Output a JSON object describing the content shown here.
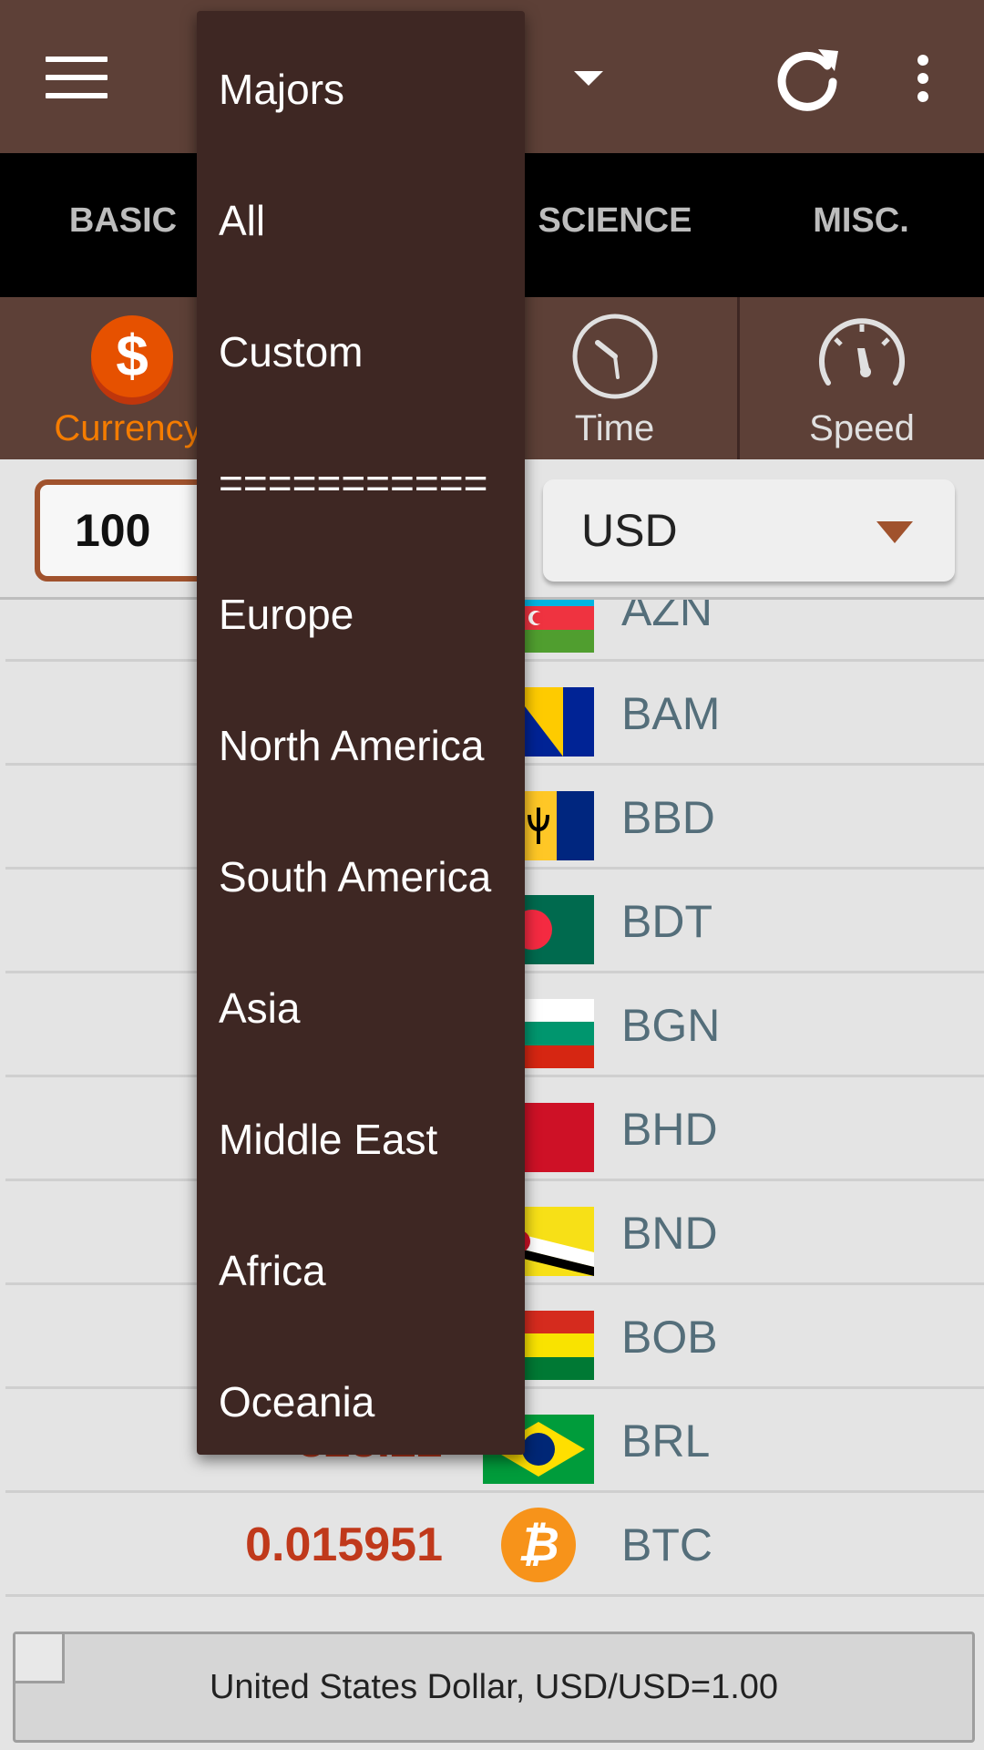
{
  "app_bar": {
    "menu_icon": "hamburger-menu-icon",
    "category_caret_icon": "caret-down-icon",
    "refresh_icon": "refresh-icon",
    "overflow_icon": "more-vert-icon"
  },
  "tabs": [
    {
      "label": "BASIC"
    },
    {
      "label": "SCIENCE"
    },
    {
      "label": "MISC."
    }
  ],
  "units": [
    {
      "label": "Currency",
      "icon": "dollar-coin-icon",
      "active": true
    },
    {
      "label": "Time",
      "icon": "clock-icon",
      "active": false
    },
    {
      "label": "Speed",
      "icon": "speedometer-icon",
      "active": false
    }
  ],
  "input": {
    "amount": "100",
    "unit": "USD"
  },
  "currency_rows": [
    {
      "value": "",
      "code": "AZN",
      "flag": "azerbaijan-flag"
    },
    {
      "value": "",
      "code": "BAM",
      "flag": "bosnia-flag"
    },
    {
      "value": "",
      "code": "BBD",
      "flag": "barbados-flag"
    },
    {
      "value": "",
      "code": "BDT",
      "flag": "bangladesh-flag"
    },
    {
      "value": "",
      "code": "BGN",
      "flag": "bulgaria-flag"
    },
    {
      "value": "",
      "code": "BHD",
      "flag": "bahrain-flag"
    },
    {
      "value": "",
      "code": "BND",
      "flag": "brunei-flag"
    },
    {
      "value": "",
      "code": "BOB",
      "flag": "bolivia-flag"
    },
    {
      "value": "328.22",
      "code": "BRL",
      "flag": "brazil-flag"
    },
    {
      "value": "0.015951",
      "code": "BTC",
      "flag": "bitcoin-icon"
    }
  ],
  "footer": {
    "text": "United States Dollar, USD/USD=1.00"
  },
  "dropdown": {
    "items": [
      "Majors",
      "All",
      "Custom",
      "===========",
      "Europe",
      "North America",
      "South America",
      "Asia",
      "Middle East",
      "Africa",
      "Oceania"
    ]
  },
  "colors": {
    "app_bar": "#5d4037",
    "dropdown": "#3e2723",
    "accent_orange": "#f57c00",
    "value_red": "#c0391b",
    "code_gray": "#546e7a"
  }
}
